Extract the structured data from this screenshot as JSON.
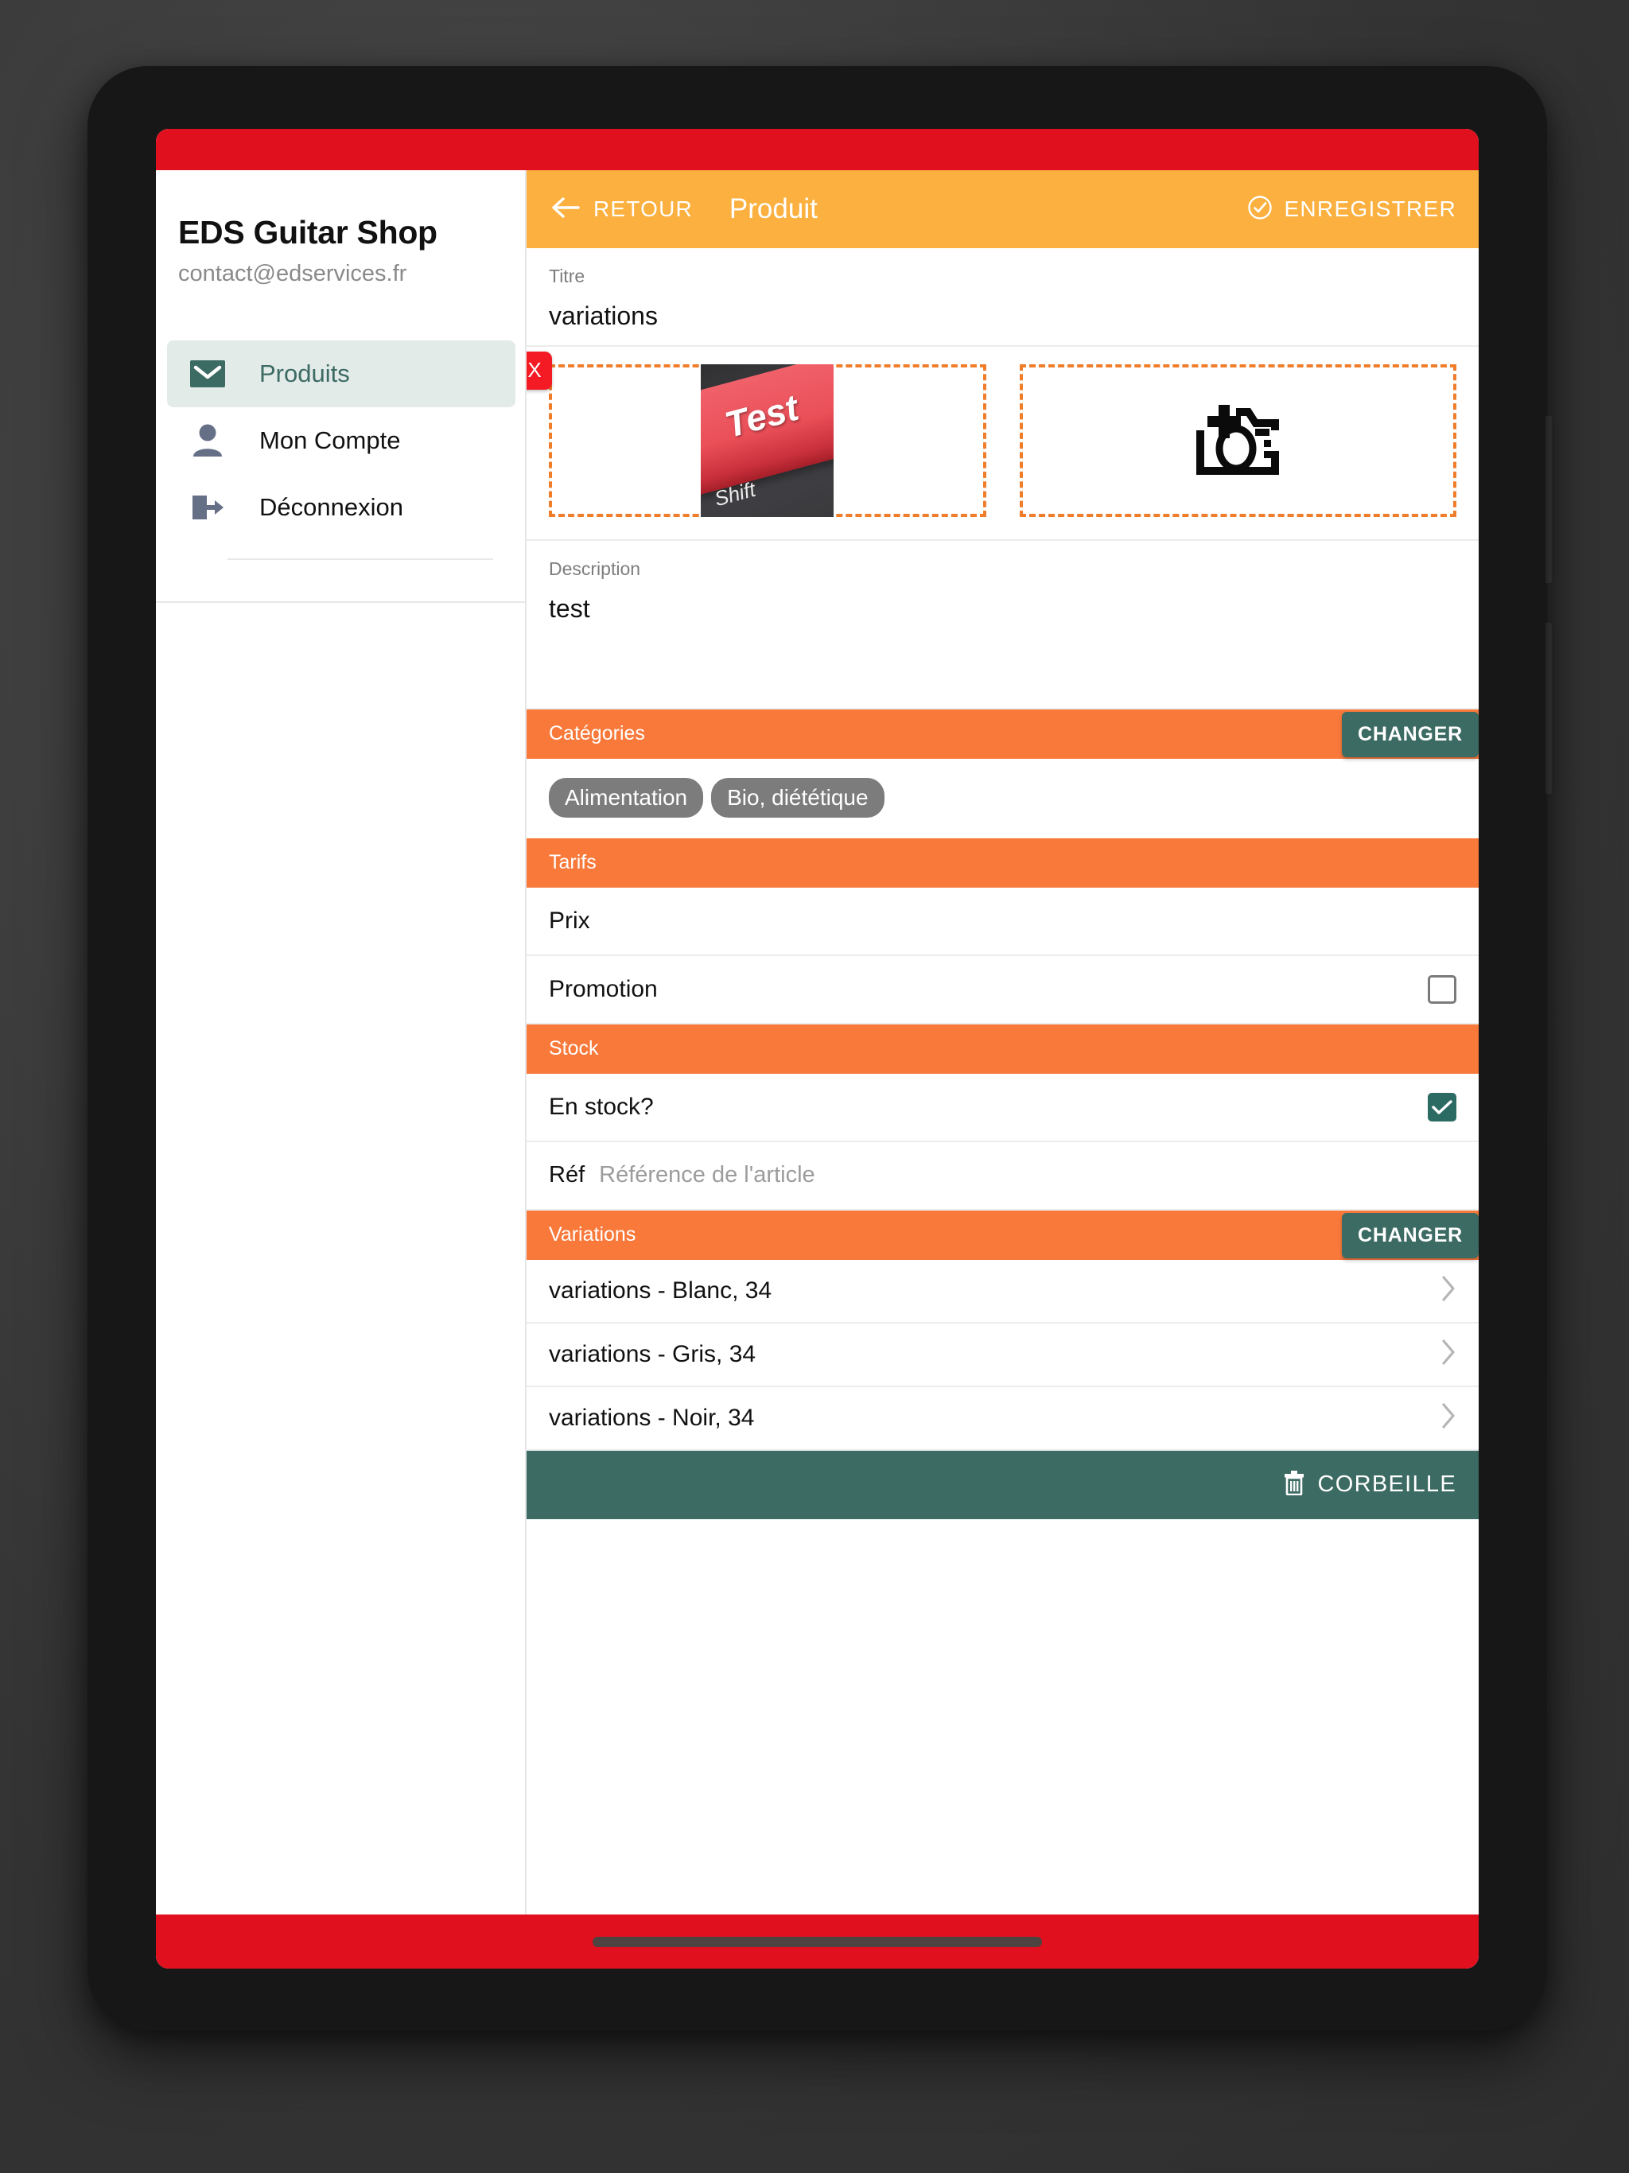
{
  "sidebar": {
    "brand_title": "EDS Guitar Shop",
    "brand_email": "contact@edservices.fr",
    "items": [
      {
        "label": "Produits",
        "icon": "mail-icon",
        "active": true
      },
      {
        "label": "Mon Compte",
        "icon": "person-icon",
        "active": false
      },
      {
        "label": "Déconnexion",
        "icon": "logout-icon",
        "active": false
      }
    ]
  },
  "app_bar": {
    "back_label": "RETOUR",
    "back_icon": "arrow-left-icon",
    "title": "Produit",
    "save_label": "ENREGISTRER",
    "save_icon": "check-circle-icon"
  },
  "title_field": {
    "label": "Titre",
    "value": "variations"
  },
  "media": {
    "remove_label": "X",
    "thumb_key_text": "Test",
    "thumb_shift_text": "Shift",
    "thumb_corner_text": "/",
    "add_icon": "add-photo-camera-icon"
  },
  "description_field": {
    "label": "Description",
    "value": "test"
  },
  "categories_section": {
    "title": "Catégories",
    "change_label": "CHANGER",
    "chips": [
      "Alimentation",
      "Bio, diététique"
    ]
  },
  "tarifs_section": {
    "title": "Tarifs",
    "rows": [
      {
        "label": "Prix",
        "has_checkbox": false,
        "checked": false
      },
      {
        "label": "Promotion",
        "has_checkbox": true,
        "checked": false
      }
    ]
  },
  "stock_section": {
    "title": "Stock",
    "in_stock_label": "En stock?",
    "in_stock_checked": true,
    "ref_label": "Réf",
    "ref_placeholder": "Référence de l'article",
    "ref_value": ""
  },
  "variations_section": {
    "title": "Variations",
    "change_label": "CHANGER",
    "rows": [
      "variations - Blanc, 34",
      "variations - Gris, 34",
      "variations - Noir, 34"
    ],
    "chevron_icon": "chevron-right-icon"
  },
  "trash_bar": {
    "label": "CORBEILLE",
    "icon": "trash-icon"
  },
  "colors": {
    "status_bar": "#e1101f",
    "app_bar": "#fbb03f",
    "section_header": "#f9793b",
    "accent_teal": "#3c6b63",
    "dashed_border": "#ef7d2a",
    "remove_red": "#f41b25",
    "chip_gray": "#7c7c7c"
  }
}
